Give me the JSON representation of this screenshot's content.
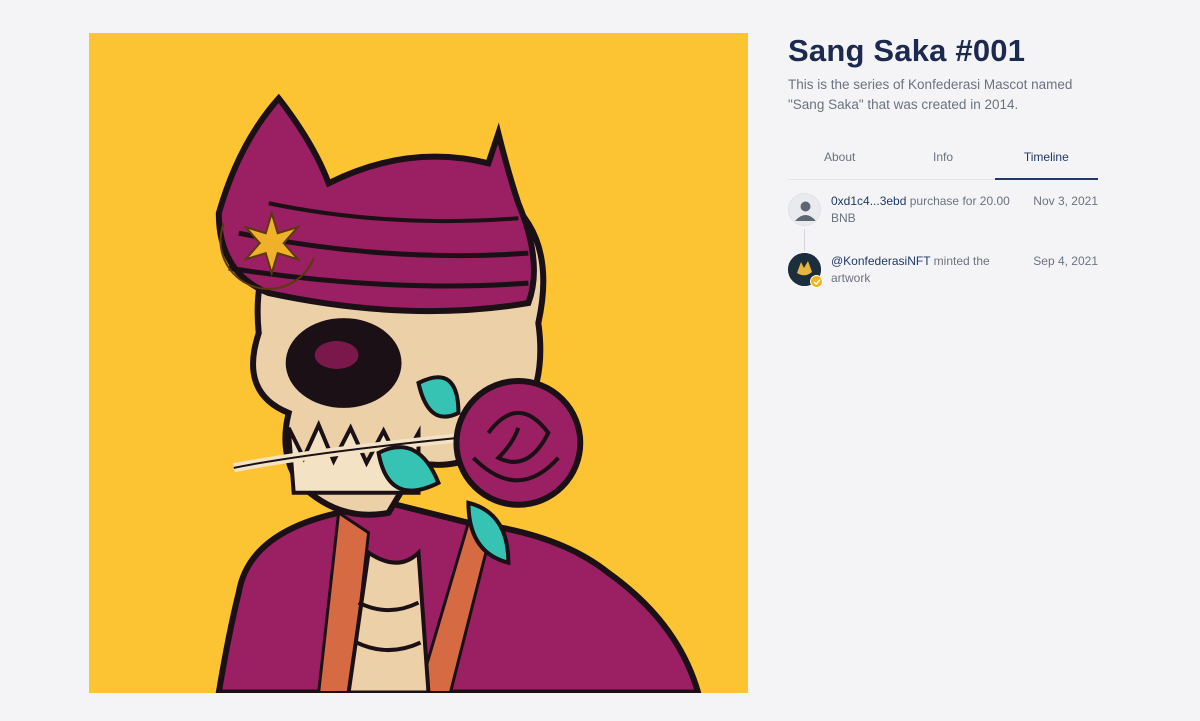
{
  "artwork": {
    "alt": "Sang Saka skull illustration",
    "background_color": "#fcc332"
  },
  "header": {
    "title": "Sang Saka #001",
    "description": "This is the series of Konfederasi Mascot named \"Sang Saka\" that was created in 2014."
  },
  "tabs": [
    {
      "label": "About",
      "active": false
    },
    {
      "label": "Info",
      "active": false
    },
    {
      "label": "Timeline",
      "active": true
    }
  ],
  "timeline": [
    {
      "avatar": "user-icon",
      "actor": "0xd1c4...3ebd",
      "action": " purchase for 20.00 BNB",
      "date": "Nov 3, 2021"
    },
    {
      "avatar": "konfederasi-logo",
      "verified": true,
      "actor": "@KonfederasiNFT",
      "action": " minted the artwork",
      "date": "Sep 4, 2021"
    }
  ],
  "colors": {
    "accent": "#1f3a68",
    "title": "#1b2a4e",
    "muted": "#6b7280",
    "badge": "#f3b41b"
  }
}
